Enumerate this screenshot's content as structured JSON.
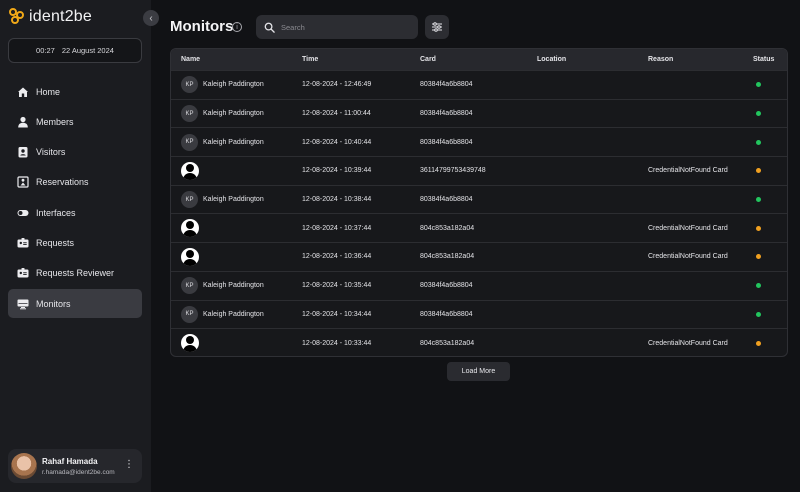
{
  "app": {
    "name": "ident2be"
  },
  "datetime": {
    "time": "00:27",
    "date": "22 August 2024"
  },
  "nav": [
    {
      "label": "Home",
      "icon": "home-icon"
    },
    {
      "label": "Members",
      "icon": "user-icon"
    },
    {
      "label": "Visitors",
      "icon": "id-badge-icon"
    },
    {
      "label": "Reservations",
      "icon": "reservation-icon"
    },
    {
      "label": "Interfaces",
      "icon": "toggle-icon"
    },
    {
      "label": "Requests",
      "icon": "id-card-icon"
    },
    {
      "label": "Requests Reviewer",
      "icon": "id-card-review-icon"
    },
    {
      "label": "Monitors",
      "icon": "monitor-icon",
      "active": true
    }
  ],
  "user": {
    "name": "Rahaf Hamada",
    "email": "r.hamada@ident2be.com"
  },
  "page": {
    "title": "Monitors"
  },
  "search": {
    "placeholder": "Search"
  },
  "table": {
    "headers": {
      "name": "Name",
      "time": "Time",
      "card": "Card",
      "location": "Location",
      "reason": "Reason",
      "status": "Status"
    },
    "rows": [
      {
        "initials": "KP",
        "name": "Kaleigh Paddington",
        "time": "12-08-2024 - 12:46:49",
        "card": "80384f4a6b8804",
        "location": "",
        "reason": "",
        "status": "success"
      },
      {
        "initials": "KP",
        "name": "Kaleigh Paddington",
        "time": "12-08-2024 - 11:00:44",
        "card": "80384f4a6b8804",
        "location": "",
        "reason": "",
        "status": "success"
      },
      {
        "initials": "KP",
        "name": "Kaleigh Paddington",
        "time": "12-08-2024 - 10:40:44",
        "card": "80384f4a6b8804",
        "location": "",
        "reason": "",
        "status": "success"
      },
      {
        "initials": "",
        "name": "",
        "time": "12-08-2024 - 10:39:44",
        "card": "36114799753439748",
        "location": "",
        "reason": "CredentialNotFound Card",
        "status": "warning"
      },
      {
        "initials": "KP",
        "name": "Kaleigh Paddington",
        "time": "12-08-2024 - 10:38:44",
        "card": "80384f4a6b8804",
        "location": "",
        "reason": "",
        "status": "success"
      },
      {
        "initials": "",
        "name": "",
        "time": "12-08-2024 - 10:37:44",
        "card": "804c853a182a04",
        "location": "",
        "reason": "CredentialNotFound Card",
        "status": "warning"
      },
      {
        "initials": "",
        "name": "",
        "time": "12-08-2024 - 10:36:44",
        "card": "804c853a182a04",
        "location": "",
        "reason": "CredentialNotFound Card",
        "status": "warning"
      },
      {
        "initials": "KP",
        "name": "Kaleigh Paddington",
        "time": "12-08-2024 - 10:35:44",
        "card": "80384f4a6b8804",
        "location": "",
        "reason": "",
        "status": "success"
      },
      {
        "initials": "KP",
        "name": "Kaleigh Paddington",
        "time": "12-08-2024 - 10:34:44",
        "card": "80384f4a6b8804",
        "location": "",
        "reason": "",
        "status": "success"
      },
      {
        "initials": "",
        "name": "",
        "time": "12-08-2024 - 10:33:44",
        "card": "804c853a182a04",
        "location": "",
        "reason": "CredentialNotFound Card",
        "status": "warning"
      }
    ]
  },
  "actions": {
    "load_more": "Load More"
  },
  "colors": {
    "success": "#22c55e",
    "warning": "#f0a020",
    "brand": "#f0a818",
    "active_nav": "#3a3b41"
  }
}
